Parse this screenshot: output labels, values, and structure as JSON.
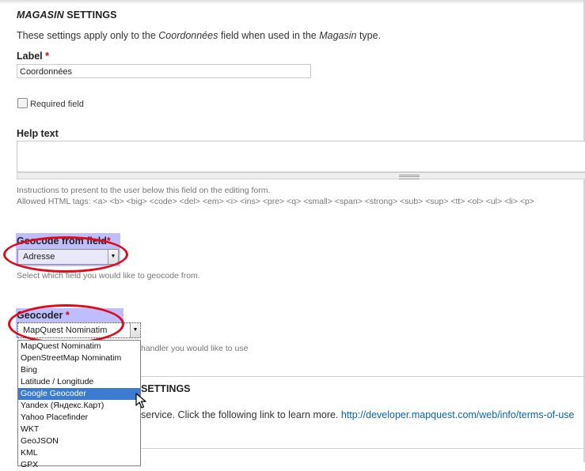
{
  "section": {
    "title_italic": "MAGASIN",
    "title_rest": " SETTINGS",
    "intro_pre": "These settings apply only to the ",
    "intro_field": "Coordonnées",
    "intro_mid": " field when used in the ",
    "intro_type": "Magasin",
    "intro_post": " type."
  },
  "label_field": {
    "label": "Label",
    "required_mark": "*",
    "value": "Coordonnées"
  },
  "required_field": {
    "label": "Required field",
    "checked": false
  },
  "help_text": {
    "label": "Help text",
    "value": "",
    "description": "Instructions to present to the user below this field on the editing form.",
    "allowed_tags": "Allowed HTML tags: <a> <b> <big> <code> <del> <em> <i> <ins> <pre> <q> <small> <span> <strong> <sub> <sup> <tt> <ol> <ul> <li> <p>"
  },
  "geocode_from_field": {
    "label": "Geocode from field",
    "required_mark": "*",
    "selected": "Adresse",
    "description": "Select which field you would like to geocode from."
  },
  "geocoder": {
    "label": "Geocoder",
    "required_mark": "*",
    "selected": "MapQuest Nominatim",
    "description_tail": "handler you would like to use",
    "options": [
      "MapQuest Nominatim",
      "OpenStreetMap Nominatim",
      "Bing",
      "Latitude / Longitude",
      "Google Geocoder",
      "Yandex (Яндекс.Карт)",
      "Yahoo Placefinder",
      "WKT",
      "GeoJSON",
      "KML",
      "GPX"
    ],
    "highlighted_option": "Google Geocoder"
  },
  "geocoder_settings": {
    "title_tail": "SETTINGS",
    "terms_text": "service. Click the following link to learn more. ",
    "terms_link": "http://developer.mapquest.com/web/info/terms-of-use"
  },
  "colors": {
    "annotation_red": "#dd0b1c",
    "annotation_highlight": "#4646ff",
    "required_red": "#e00000",
    "link_blue": "#0b65a6",
    "selected_option_bg": "#3d7bd1"
  },
  "icons": {
    "select_arrow": "chevron-down-icon",
    "mouse_pointer": "cursor-arrow-icon"
  }
}
